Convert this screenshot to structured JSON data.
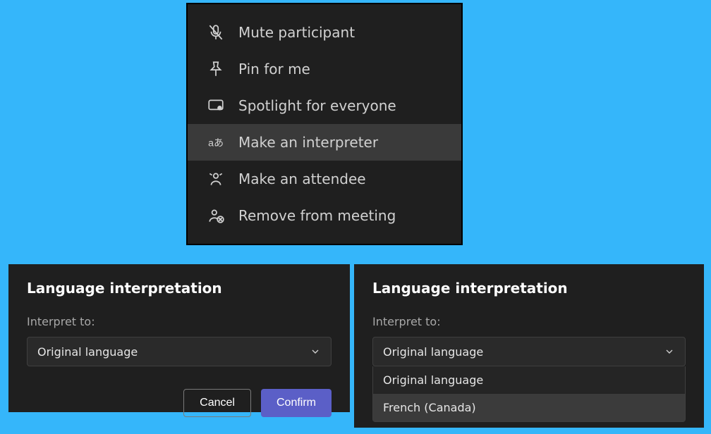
{
  "context_menu": {
    "items": [
      {
        "label": "Mute participant",
        "icon": "mic-off-icon",
        "highlight": false
      },
      {
        "label": "Pin for me",
        "icon": "pin-icon",
        "highlight": false
      },
      {
        "label": "Spotlight for everyone",
        "icon": "spotlight-icon",
        "highlight": false
      },
      {
        "label": "Make an interpreter",
        "icon": "translate-icon",
        "highlight": true
      },
      {
        "label": "Make an attendee",
        "icon": "attendee-icon",
        "highlight": false
      },
      {
        "label": "Remove from meeting",
        "icon": "remove-person-icon",
        "highlight": false
      }
    ]
  },
  "dialog_left": {
    "title": "Language interpretation",
    "label": "Interpret to:",
    "selected": "Original language",
    "cancel": "Cancel",
    "confirm": "Confirm"
  },
  "dialog_right": {
    "title": "Language interpretation",
    "label": "Interpret to:",
    "selected": "Original language",
    "options": [
      "Original language",
      "French (Canada)"
    ]
  }
}
